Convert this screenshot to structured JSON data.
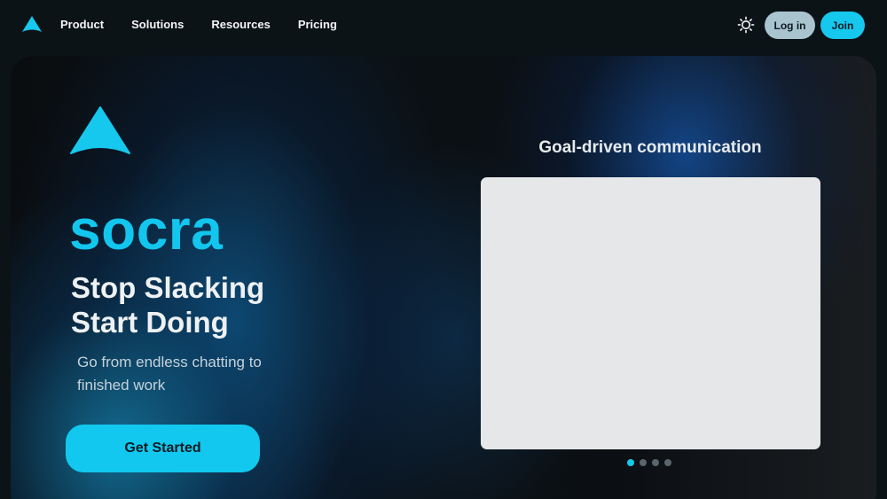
{
  "nav": {
    "logo_icon": "arrow-logo-icon",
    "links": [
      "Product",
      "Solutions",
      "Resources",
      "Pricing"
    ],
    "theme_icon": "sun-icon",
    "login_label": "Log in",
    "join_label": "Join"
  },
  "hero": {
    "logo_icon": "arrow-logo-icon",
    "brand": "socra",
    "headline_line1": "Stop Slacking",
    "headline_line2": "Start Doing",
    "subhead": "Go from endless chatting to finished work",
    "cta_label": "Get Started"
  },
  "carousel": {
    "title": "Goal-driven communication",
    "slide_count": 4,
    "active_slide": 1
  },
  "colors": {
    "accent": "#16c8ee",
    "login_bg": "#a9c4cf",
    "background": "#0c1317",
    "frame": "#e5e7e9"
  }
}
